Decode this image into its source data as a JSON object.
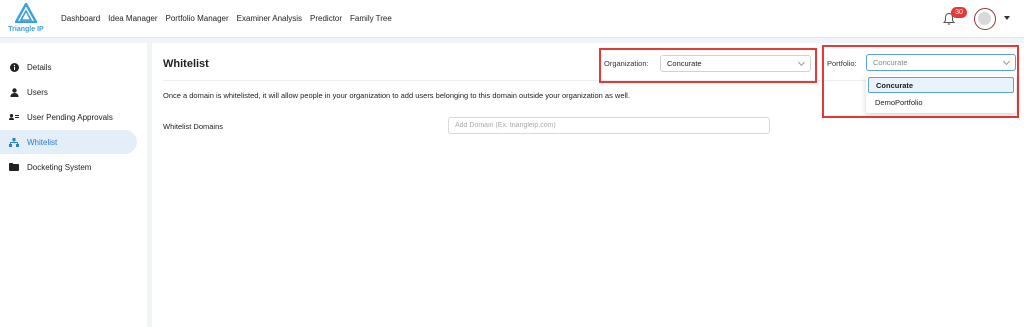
{
  "app": {
    "logo_text": "Triangle IP"
  },
  "nav": {
    "items": [
      "Dashboard",
      "Idea Manager",
      "Portfolio Manager",
      "Examiner Analysis",
      "Predictor",
      "Family Tree"
    ]
  },
  "notifications": {
    "count": "30"
  },
  "sidebar": {
    "items": [
      {
        "label": "Details",
        "icon": "info-icon"
      },
      {
        "label": "Users",
        "icon": "user-icon"
      },
      {
        "label": "User Pending Approvals",
        "icon": "id-card-icon"
      },
      {
        "label": "Whitelist",
        "icon": "sitemap-icon",
        "active": true
      },
      {
        "label": "Docketing System",
        "icon": "folder-icon"
      }
    ]
  },
  "main": {
    "title": "Whitelist",
    "description": "Once a domain is whitelisted, it will allow people in your organization to add users belonging to this domain outside your organization as well.",
    "whitelist_label": "Whitelist Domains",
    "domain_placeholder": "Add Domain (Ex. triangleip.com)"
  },
  "organization": {
    "label": "Organization:",
    "value": "Concurate"
  },
  "portfolio": {
    "label": "Portfolio:",
    "placeholder": "Concurate",
    "options": [
      "Concurate",
      "DemoPortfolio"
    ],
    "selected": "Concurate"
  },
  "colors": {
    "accent": "#2a7fc9",
    "highlight": "#e53935",
    "badge": "#e53935",
    "logo": "#3aa0e0"
  }
}
